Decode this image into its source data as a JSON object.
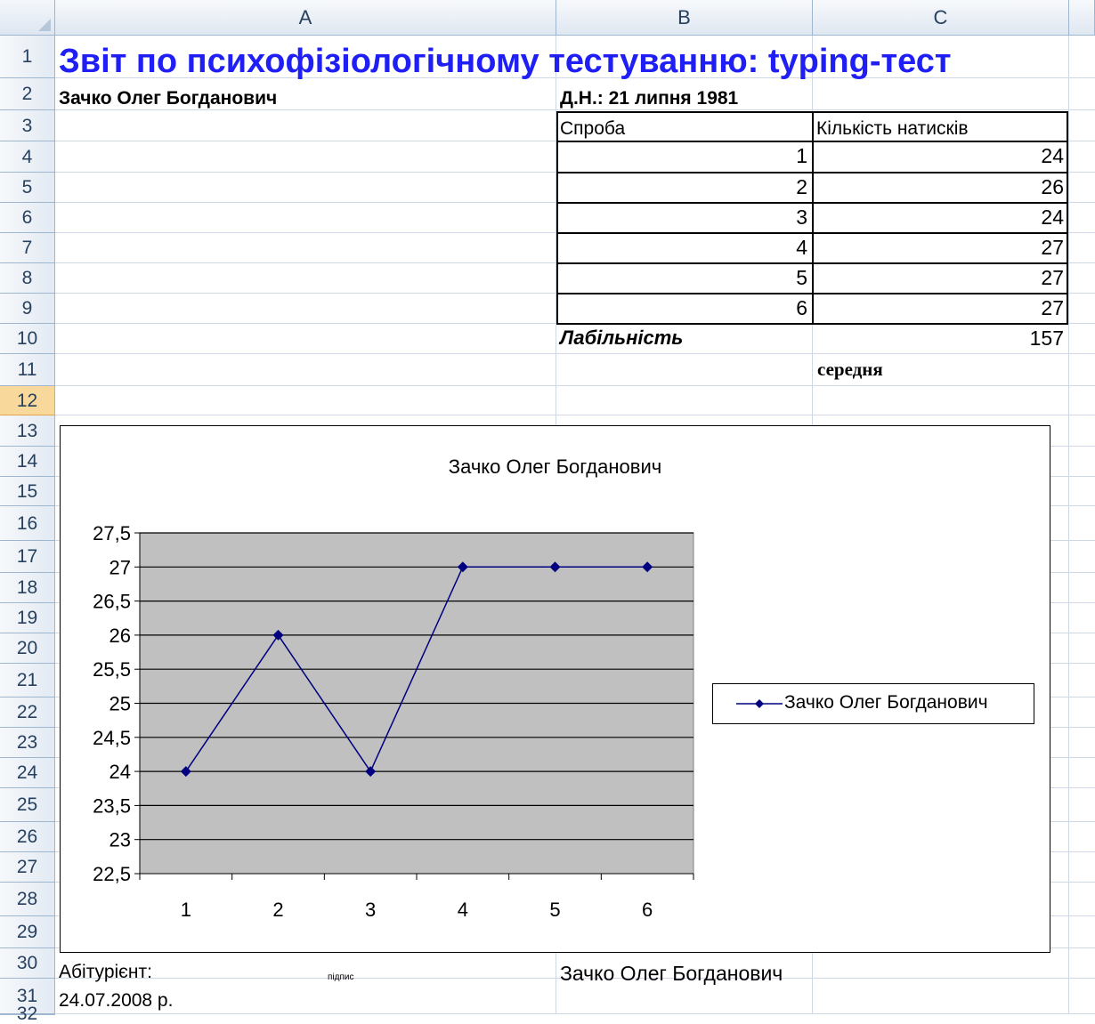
{
  "columns": [
    "A",
    "B",
    "C"
  ],
  "rows": [
    "1",
    "2",
    "3",
    "4",
    "5",
    "6",
    "7",
    "8",
    "9",
    "10",
    "11",
    "12",
    "13",
    "14",
    "15",
    "16",
    "17",
    "18",
    "19",
    "20",
    "21",
    "22",
    "23",
    "24",
    "25",
    "26",
    "27",
    "28",
    "29",
    "30",
    "31",
    "32"
  ],
  "selected_row": "12",
  "report": {
    "title": "Звіт по психофізіологічному тестуванню: typing-тест",
    "name": "Зачко Олег Богданович",
    "birth": "Д.Н.: 21 липня 1981",
    "table_header_attempt": "Спроба",
    "table_header_count": "Кількість натисків",
    "table_rows": [
      {
        "attempt": "1",
        "count": "24"
      },
      {
        "attempt": "2",
        "count": "26"
      },
      {
        "attempt": "3",
        "count": "24"
      },
      {
        "attempt": "4",
        "count": "27"
      },
      {
        "attempt": "5",
        "count": "27"
      },
      {
        "attempt": "6",
        "count": "27"
      }
    ],
    "lability_label": "Лабільність",
    "lability_value": "157",
    "level": "середня",
    "applicant_label": "Абітурієнт:",
    "signature_label": "підпис",
    "signer_name": "Зачко Олег Богданович",
    "date": "24.07.2008 р."
  },
  "chart_data": {
    "type": "line",
    "title": "Зачко Олег Богданович",
    "categories": [
      "1",
      "2",
      "3",
      "4",
      "5",
      "6"
    ],
    "series": [
      {
        "name": "Зачко Олег Богданович",
        "values": [
          24,
          26,
          24,
          27,
          27,
          27
        ]
      }
    ],
    "ylim": [
      22.5,
      27.5
    ],
    "yticks": [
      "22,5",
      "23",
      "23,5",
      "24",
      "24,5",
      "25",
      "25,5",
      "26",
      "26,5",
      "27",
      "27,5"
    ],
    "grid": true,
    "legend": "right",
    "colors": {
      "plot_bg": "#c0c0c0",
      "series": "#000080"
    }
  }
}
